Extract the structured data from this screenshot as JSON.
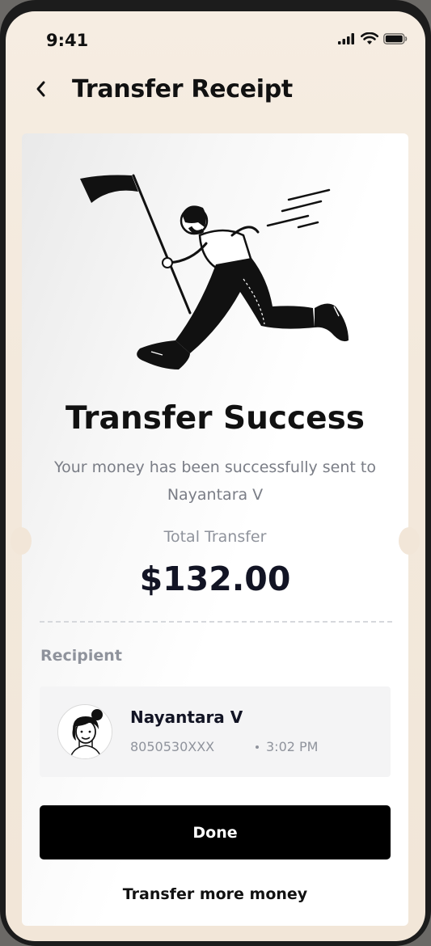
{
  "status_bar": {
    "time": "9:41"
  },
  "header": {
    "title": "Transfer Receipt",
    "back_icon": "chevron-left-icon"
  },
  "receipt": {
    "title": "Transfer Success",
    "message": "Your money has been successfully sent to Nayantara V",
    "total_label": "Total Transfer",
    "total_amount": "$132.00"
  },
  "recipient": {
    "section_label": "Recipient",
    "name": "Nayantara V",
    "phone": "8050530XXX",
    "time": "3:02 PM"
  },
  "actions": {
    "done_label": "Done",
    "more_label": "Transfer more money"
  },
  "colors": {
    "primary_button": "#000000",
    "background": "#f3e9dc",
    "muted_text": "#8f939c"
  }
}
